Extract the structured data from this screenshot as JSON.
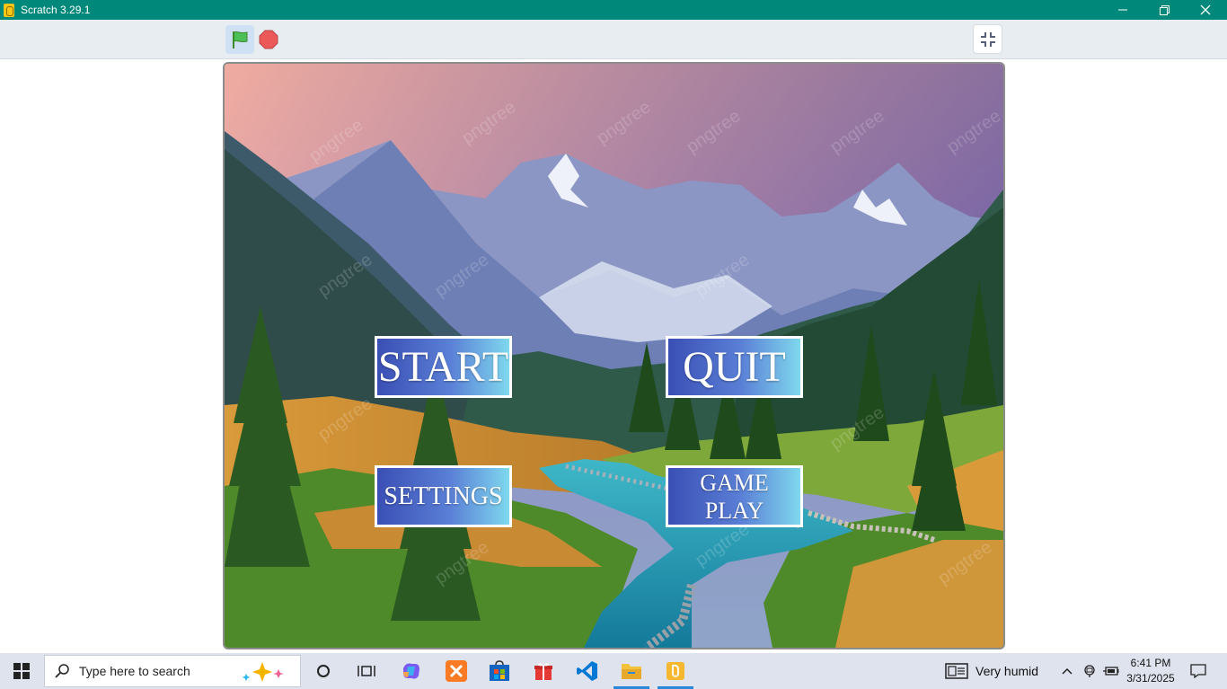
{
  "window": {
    "title": "Scratch 3.29.1",
    "controls": {
      "minimize": "minimize-icon",
      "restore": "restore-icon",
      "close": "close-icon"
    }
  },
  "toolbar": {
    "green_flag": "green-flag-icon",
    "stop": "stop-icon",
    "fullscreen": "unfullscreen-icon"
  },
  "stage": {
    "buttons": {
      "start": "START",
      "quit": "QUIT",
      "settings": "SETTINGS",
      "gameplay_line1": "GAME",
      "gameplay_line2": "PLAY"
    },
    "watermark": "pngtree"
  },
  "taskbar": {
    "search_placeholder": "Type here to search",
    "weather": "Very humid",
    "time": "6:41 PM",
    "date": "3/31/2025",
    "apps": [
      "task-view-icon",
      "widgets-icon",
      "copilot-icon",
      "xampp-icon",
      "store-icon",
      "gift-icon",
      "vscode-icon",
      "file-explorer-icon",
      "scratch-icon"
    ]
  },
  "colors": {
    "titlebar": "#00897b",
    "toolbar": "#e8edf1",
    "taskbar": "#dfe3ee",
    "button_gradient_start": "#3a4fb5",
    "button_gradient_end": "#7fd8ee"
  }
}
